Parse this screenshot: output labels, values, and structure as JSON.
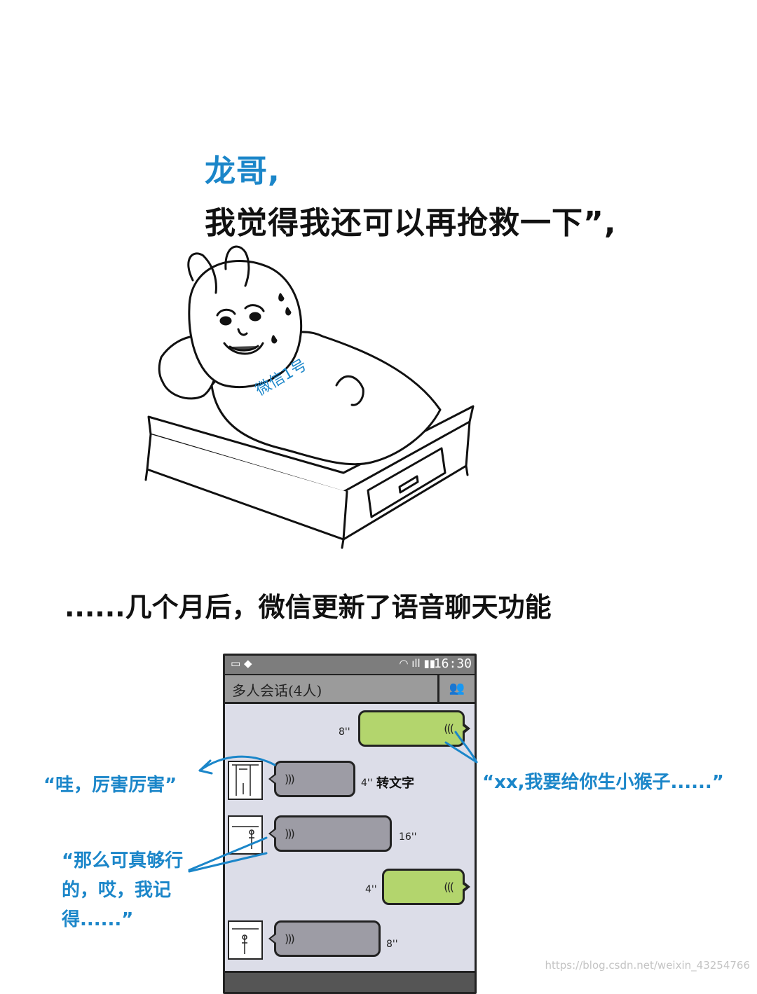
{
  "header": {
    "line1": "龙哥,",
    "line2": "我觉得我还可以再抢救一下”,"
  },
  "illustration": {
    "blanket_text": "微信1号"
  },
  "subtitle": "......几个月后，微信更新了语音聊天功能",
  "phone": {
    "status": {
      "time": "16:30"
    },
    "chat_title": "多人会话(4人)",
    "messages": [
      {
        "side": "right",
        "color": "green",
        "duration": "8''"
      },
      {
        "side": "left",
        "color": "grey",
        "duration": "4''",
        "extra": "转文字"
      },
      {
        "side": "left",
        "color": "grey",
        "duration": "16''"
      },
      {
        "side": "right",
        "color": "green",
        "duration": "4''"
      },
      {
        "side": "left",
        "color": "grey",
        "duration": "8''"
      }
    ]
  },
  "annotations": {
    "left_top": "“哇，厉害厉害”",
    "right": "“xx,我要给你生小猴子......”",
    "left_bottom": "“那么可真够行的，哎，我记得......”"
  },
  "watermark": "https://blog.csdn.net/weixin_43254766",
  "colors": {
    "accent_blue": "#1b86c9",
    "green_bubble": "#b3d56d",
    "grey_bubble": "#9d9ca5",
    "chat_bg": "#dcdde8"
  }
}
